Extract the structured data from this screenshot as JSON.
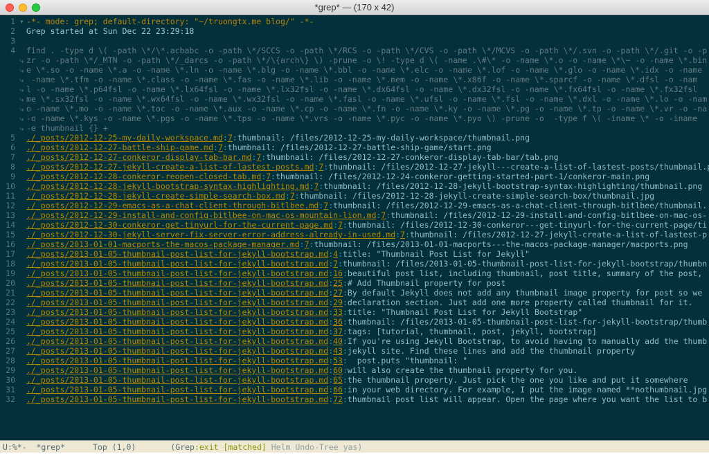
{
  "window": {
    "title": "*grep*  —  (170 x 42)"
  },
  "header": [
    {
      "num": "1",
      "fold": "▾",
      "cls": "c-comment",
      "text": "-*- mode: grep; default-directory: \"~/truongtx.me blog/\" -*-"
    },
    {
      "num": "2",
      "fold": "",
      "cls": "c-default",
      "text": "Grep started at Sun Dec 22 23:29:18"
    },
    {
      "num": "3",
      "fold": "",
      "cls": "c-default",
      "text": ""
    }
  ],
  "find_cmd": [
    {
      "num": "4",
      "fold": "",
      "text": "find . -type d \\( -path \\*/\\*.acbabc -o -path \\*/SCCS -o -path \\*/RCS -o -path \\*/CVS -o -path \\*/MCVS -o -path \\*/.svn -o -path \\*/.git -o -p"
    },
    {
      "num": "",
      "fold": "⤷",
      "text": "zr -o -path \\*/_MTN -o -path \\*/_darcs -o -path \\*/\\{arch\\} \\) -prune -o \\! -type d \\( -name .\\#\\* -o -name \\*.o -o -name \\*\\~ -o -name \\*.bin"
    },
    {
      "num": "",
      "fold": "⤷",
      "text": "e \\*.so -o -name \\*.a -o -name \\*.ln -o -name \\*.blg -o -name \\*.bbl -o -name \\*.elc -o -name \\*.lof -o -name \\*.glo -o -name \\*.idx -o -name "
    },
    {
      "num": "",
      "fold": "⤷",
      "text": " -name \\*.tfm -o -name \\*.class -o -name \\*.fas -o -name \\*.lib -o -name \\*.mem -o -name \\*.x86f -o -name \\*.sparcf -o -name \\*.dfsl -o -nam"
    },
    {
      "num": "",
      "fold": "⤷",
      "text": "l -o -name \\*.p64fsl -o -name \\*.lx64fsl -o -name \\*.lx32fsl -o -name \\*.dx64fsl -o -name \\*.dx32fsl -o -name \\*.fx64fsl -o -name \\*.fx32fsl "
    },
    {
      "num": "",
      "fold": "⤷",
      "text": "me \\*.sx32fsl -o -name \\*.wx64fsl -o -name \\*.wx32fsl -o -name \\*.fasl -o -name \\*.ufsl -o -name \\*.fsl -o -name \\*.dxl -o -name \\*.lo -o -nam"
    },
    {
      "num": "",
      "fold": "⤷",
      "text": "o -name \\*.mo -o -name \\*.toc -o -name \\*.aux -o -name \\*.cp -o -name \\*.fn -o -name \\*.ky -o -name \\*.pg -o -name \\*.tp -o -name \\*.vr -o -na"
    },
    {
      "num": "",
      "fold": "⤷",
      "text": "-o -name \\*.kys -o -name \\*.pgs -o -name \\*.tps -o -name \\*.vrs -o -name \\*.pyc -o -name \\*.pyo \\) -prune -o  -type f \\( -iname \\* -o -iname "
    },
    {
      "num": "",
      "fold": "⤷",
      "text": "-e thumbnail {} +"
    }
  ],
  "results": [
    {
      "num": "5",
      "file": "./_posts/2012-12-25-my-daily-workspace.md",
      "loc": "7",
      "msg": "thumbnail: /files/2012-12-25-my-daily-workspace/thumbnail.png"
    },
    {
      "num": "6",
      "file": "./_posts/2012-12-27-battle-ship-game.md",
      "loc": "7",
      "msg": "thumbnail: /files/2012-12-27-battle-ship-game/start.png"
    },
    {
      "num": "7",
      "file": "./_posts/2012-12-27-conkeror-display-tab-bar.md",
      "loc": "7",
      "msg": "thumbnail: /files/2012-12-27-conkeror-display-tab-bar/tab.png"
    },
    {
      "num": "8",
      "file": "./_posts/2012-12-27-jekyll-create-a-list-of-lastest-posts.md",
      "loc": "7",
      "msg": "thumbnail: /files/2012-12-27-jekyll---create-a-list-of-lastest-posts/thumbnail.pn"
    },
    {
      "num": "9",
      "file": "./_posts/2012-12-28-conkeror-reopen-closed-tab.md",
      "loc": "7",
      "msg": "thumbnail: /files/2012-12-24-conkeror-getting-started-part-1/conkeror-main.png"
    },
    {
      "num": "10",
      "file": "./_posts/2012-12-28-jekyll-bootstrap-syntax-highlighting.md",
      "loc": "7",
      "msg": "thumbnail: /files/2012-12-28-jekyll-bootstrap-syntax-highlighting/thumbnail.png"
    },
    {
      "num": "11",
      "file": "./_posts/2012-12-28-jekyll-create-simple-search-box.md",
      "loc": "7",
      "msg": "thumbnail: /files/2012-12-28-jekyll-create-simple-search-box/thumbnail.jpg"
    },
    {
      "num": "12",
      "file": "./_posts/2012-12-29-emacs-as-a-chat-client-through-bitlbee.md",
      "loc": "7",
      "msg": "thumbnail: /files/2012-12-29-emacs-as-a-chat-client-through-bitlbee/thumbnail."
    },
    {
      "num": "13",
      "file": "./_posts/2012-12-29-install-and-config-bitlbee-on-mac-os-mountain-lion.md",
      "loc": "7",
      "msg": "thumbnail: /files/2012-12-29-install-and-config-bitlbee-on-mac-os-"
    },
    {
      "num": "14",
      "file": "./_posts/2012-12-30-conkeror-get-tinyurl-for-the-current-page.md",
      "loc": "7",
      "msg": "thumbnail: /files/2012-12-30-conkeror---get-tinyurl-for-the-current-page/ti"
    },
    {
      "num": "15",
      "file": "./_posts/2012-12-30-jekyll-server-fix-server-error-address-already-in-used.md",
      "loc": "7",
      "msg": "thumbnail: /files/2012-12-27-jekyll-create-a-list-of-lastest-p"
    },
    {
      "num": "16",
      "file": "./_posts/2013-01-01-macports-the-macos-package-manager.md",
      "loc": "7",
      "msg": "thumbnail: /files/2013-01-01-macports---the-macos-package-manager/macports.png"
    },
    {
      "num": "17",
      "file": "./_posts/2013-01-05-thumbnail-post-list-for-jekyll-bootstrap.md",
      "loc": "4",
      "msg": "title: \"Thumbnail Post List for Jekyll\""
    },
    {
      "num": "18",
      "file": "./_posts/2013-01-05-thumbnail-post-list-for-jekyll-bootstrap.md",
      "loc": "7",
      "msg": "thumbnail: /files/2013-01-05-thumbnail-post-list-for-jekyll-bootstrap/thumbn"
    },
    {
      "num": "19",
      "file": "./_posts/2013-01-05-thumbnail-post-list-for-jekyll-bootstrap.md",
      "loc": "16",
      "msg": "beautiful post list, including thumbnail, post title, summary of the post, "
    },
    {
      "num": "20",
      "file": "./_posts/2013-01-05-thumbnail-post-list-for-jekyll-bootstrap.md",
      "loc": "25",
      "msg": "# Add Thumbnail property for post"
    },
    {
      "num": "21",
      "file": "./_posts/2013-01-05-thumbnail-post-list-for-jekyll-bootstrap.md",
      "loc": "27",
      "msg": "By default Jekyll does not add any thumbnail image property for post so we "
    },
    {
      "num": "22",
      "file": "./_posts/2013-01-05-thumbnail-post-list-for-jekyll-bootstrap.md",
      "loc": "29",
      "msg": "declaration section. Just add one more property called thumbnail for it."
    },
    {
      "num": "23",
      "file": "./_posts/2013-01-05-thumbnail-post-list-for-jekyll-bootstrap.md",
      "loc": "33",
      "msg": "title: \"Thumbnail Post List for Jekyll Bootstrap\""
    },
    {
      "num": "24",
      "file": "./_posts/2013-01-05-thumbnail-post-list-for-jekyll-bootstrap.md",
      "loc": "36",
      "msg": "thumbnail: /files/2013-01-05-thumbnail-post-list-for-jekyll-bootstrap/thumb"
    },
    {
      "num": "25",
      "file": "./_posts/2013-01-05-thumbnail-post-list-for-jekyll-bootstrap.md",
      "loc": "37",
      "msg": "tags: [tutorial, thumbnail, post, jekyll, bootstrap]"
    },
    {
      "num": "26",
      "file": "./_posts/2013-01-05-thumbnail-post-list-for-jekyll-bootstrap.md",
      "loc": "40",
      "msg": "If you're using Jekyll Bootstrap, to avoid having to manually add the thumb"
    },
    {
      "num": "27",
      "file": "./_posts/2013-01-05-thumbnail-post-list-for-jekyll-bootstrap.md",
      "loc": "43",
      "msg": "jekyll site. Find these lines and add the thumbnail property"
    },
    {
      "num": "28",
      "file": "./_posts/2013-01-05-thumbnail-post-list-for-jekyll-bootstrap.md",
      "loc": "53",
      "msg": "  post.puts \"thumbnail: \""
    },
    {
      "num": "29",
      "file": "./_posts/2013-01-05-thumbnail-post-list-for-jekyll-bootstrap.md",
      "loc": "60",
      "msg": "will also create the thumbnail property for you."
    },
    {
      "num": "30",
      "file": "./_posts/2013-01-05-thumbnail-post-list-for-jekyll-bootstrap.md",
      "loc": "65",
      "msg": "the thumbnail property. Just pick the one you like and put it somewhere"
    },
    {
      "num": "31",
      "file": "./_posts/2013-01-05-thumbnail-post-list-for-jekyll-bootstrap.md",
      "loc": "66",
      "msg": "in your web directory. For example, I put the image named **nothumbnail.jpg"
    },
    {
      "num": "32",
      "file": "./_posts/2013-01-05-thumbnail-post-list-for-jekyll-bootstrap.md",
      "loc": "72",
      "msg": "thumbnail post list will appear. Open the page where you want the list to b"
    }
  ],
  "modeline": {
    "left": "U:%*-  *grep*",
    "pos": "Top (1,0)",
    "mode_open": "(Grep",
    "exit": ":exit ",
    "matched": "[matched]",
    "minor": " Helm Undo-Tree yas)"
  }
}
